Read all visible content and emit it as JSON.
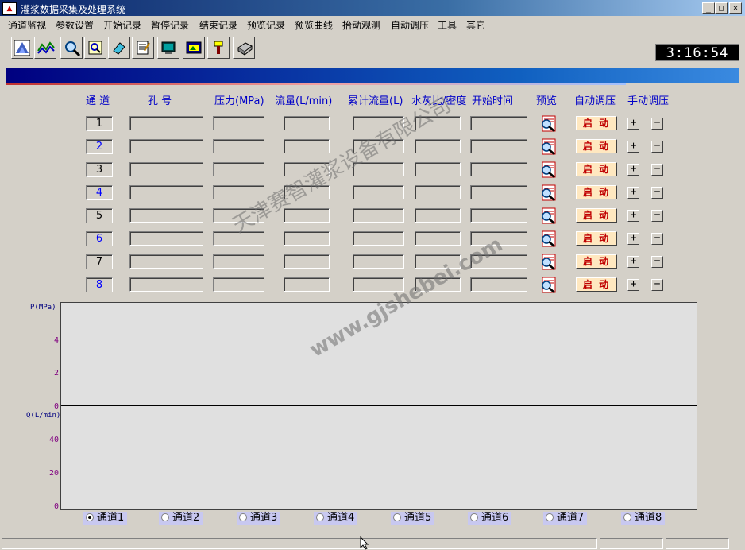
{
  "window": {
    "title": "灌浆数据采集及处理系统",
    "minimize": "_",
    "maximize": "□",
    "close": "×"
  },
  "menu": [
    "通道监视",
    "参数设置",
    "开始记录",
    "暂停记录",
    "结束记录",
    "预览记录",
    "预览曲线",
    "抬动观测",
    "自动调压",
    "工具",
    "其它"
  ],
  "toolbar": {
    "icons": [
      "mountain-icon",
      "wave-chart-icon",
      "magnifier-icon",
      "zoom-doc-icon",
      "eraser-icon",
      "notepad-icon",
      "monitor-icon",
      "image-icon",
      "brush-icon",
      "printer-icon"
    ]
  },
  "clock": "3:16:54",
  "table": {
    "headers": {
      "channel": "通  道",
      "hole": "孔  号",
      "pressure": "压力(MPa)",
      "flow": "流量(L/min)",
      "cumflow": "累计流量(L)",
      "ratio": "水灰比/密度",
      "starttime": "开始时间",
      "preview": "预览",
      "auto": "自动调压",
      "manual": "手动调压"
    },
    "rows": [
      {
        "channel": "1",
        "color": "#000000"
      },
      {
        "channel": "2",
        "color": "#0000ff"
      },
      {
        "channel": "3",
        "color": "#000000"
      },
      {
        "channel": "4",
        "color": "#0000ff"
      },
      {
        "channel": "5",
        "color": "#000000"
      },
      {
        "channel": "6",
        "color": "#0000ff"
      },
      {
        "channel": "7",
        "color": "#000000"
      },
      {
        "channel": "8",
        "color": "#0000ff"
      }
    ],
    "start_label": "启 动",
    "plus": "+",
    "minus": "−"
  },
  "chart": {
    "p_label": "P(MPa)",
    "q_label": "Q(L/min)",
    "p_ticks": [
      "4",
      "2",
      "0"
    ],
    "q_ticks": [
      "40",
      "20",
      "0"
    ]
  },
  "channels": {
    "selected": 0,
    "options": [
      "通道1",
      "通道2",
      "通道3",
      "通道4",
      "通道5",
      "通道6",
      "通道7",
      "通道8"
    ]
  },
  "watermark": {
    "line1": "天津赛智灌浆设备有限公司",
    "line2": "www.gjshebei.com"
  },
  "colors": {
    "accent_blue": "#0000c8",
    "start_text": "#c00000",
    "clock_bg": "#000000"
  }
}
